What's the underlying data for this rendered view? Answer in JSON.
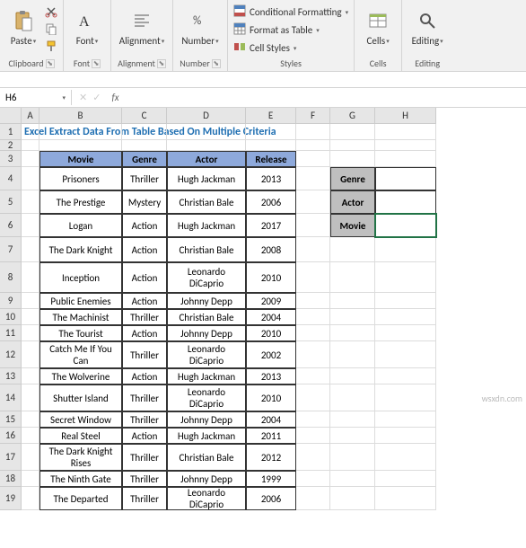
{
  "ribbon": {
    "groups": {
      "clipboard": {
        "label": "Clipboard",
        "paste": "Paste"
      },
      "font": {
        "label": "Font",
        "btn": "Font"
      },
      "alignment": {
        "label": "Alignment",
        "btn": "Alignment"
      },
      "number": {
        "label": "Number",
        "btn": "Number"
      },
      "styles": {
        "label": "Styles",
        "conditional": "Conditional Formatting",
        "format_table": "Format as Table",
        "cell_styles": "Cell Styles"
      },
      "cells": {
        "label": "Cells",
        "btn": "Cells"
      },
      "editing": {
        "label": "Editing",
        "btn": "Editing"
      }
    }
  },
  "namebox": "H6",
  "formula": "",
  "col_labels": [
    "A",
    "B",
    "C",
    "D",
    "E",
    "F",
    "G",
    "H"
  ],
  "row_labels": [
    "1",
    "2",
    "3",
    "4",
    "5",
    "6",
    "7",
    "8",
    "9",
    "10",
    "11",
    "12",
    "13",
    "14",
    "15",
    "16",
    "17",
    "18",
    "19"
  ],
  "title": "Excel Extract Data From Table Based On Multiple Criteria",
  "table": {
    "headers": [
      "Movie",
      "Genre",
      "Actor",
      "Release"
    ],
    "rows": [
      [
        "Prisoners",
        "Thriller",
        "Hugh Jackman",
        "2013"
      ],
      [
        "The Prestige",
        "Mystery",
        "Christian Bale",
        "2006"
      ],
      [
        "Logan",
        "Action",
        "Hugh Jackman",
        "2017"
      ],
      [
        "The Dark Knight",
        "Action",
        "Christian Bale",
        "2008"
      ],
      [
        "Inception",
        "Action",
        "Leonardo DiCaprio",
        "2010"
      ],
      [
        "Public Enemies",
        "Action",
        "Johnny Depp",
        "2009"
      ],
      [
        "The Machinist",
        "Thriller",
        "Christian Bale",
        "2004"
      ],
      [
        "The Tourist",
        "Action",
        "Johnny Depp",
        "2010"
      ],
      [
        "Catch Me If You Can",
        "Thriller",
        "Leonardo DiCaprio",
        "2002"
      ],
      [
        "The Wolverine",
        "Action",
        "Hugh Jackman",
        "2013"
      ],
      [
        "Shutter Island",
        "Thriller",
        "Leonardo DiCaprio",
        "2010"
      ],
      [
        "Secret Window",
        "Thriller",
        "Johnny Depp",
        "2004"
      ],
      [
        "Real Steel",
        "Action",
        "Hugh Jackman",
        "2011"
      ],
      [
        "The Dark Knight Rises",
        "Thriller",
        "Christian Bale",
        "2012"
      ],
      [
        "The Ninth Gate",
        "Thriller",
        "Johnny Depp",
        "1999"
      ],
      [
        "The Departed",
        "Thriller",
        "Leonardo DiCaprio",
        "2006"
      ]
    ]
  },
  "side": {
    "labels": [
      "Genre",
      "Actor",
      "Movie"
    ],
    "values": [
      "",
      "",
      ""
    ]
  },
  "watermark": "wsxdn.com",
  "chart_data": {
    "type": "table",
    "title": "Excel Extract Data From Table Based On Multiple Criteria",
    "columns": [
      "Movie",
      "Genre",
      "Actor",
      "Release"
    ],
    "rows": [
      [
        "Prisoners",
        "Thriller",
        "Hugh Jackman",
        2013
      ],
      [
        "The Prestige",
        "Mystery",
        "Christian Bale",
        2006
      ],
      [
        "Logan",
        "Action",
        "Hugh Jackman",
        2017
      ],
      [
        "The Dark Knight",
        "Action",
        "Christian Bale",
        2008
      ],
      [
        "Inception",
        "Action",
        "Leonardo DiCaprio",
        2010
      ],
      [
        "Public Enemies",
        "Action",
        "Johnny Depp",
        2009
      ],
      [
        "The Machinist",
        "Thriller",
        "Christian Bale",
        2004
      ],
      [
        "The Tourist",
        "Action",
        "Johnny Depp",
        2010
      ],
      [
        "Catch Me If You Can",
        "Thriller",
        "Leonardo DiCaprio",
        2002
      ],
      [
        "The Wolverine",
        "Action",
        "Hugh Jackman",
        2013
      ],
      [
        "Shutter Island",
        "Thriller",
        "Leonardo DiCaprio",
        2010
      ],
      [
        "Secret Window",
        "Thriller",
        "Johnny Depp",
        2004
      ],
      [
        "Real Steel",
        "Action",
        "Hugh Jackman",
        2011
      ],
      [
        "The Dark Knight Rises",
        "Thriller",
        "Christian Bale",
        2012
      ],
      [
        "The Ninth Gate",
        "Thriller",
        "Johnny Depp",
        1999
      ],
      [
        "The Departed",
        "Thriller",
        "Leonardo DiCaprio",
        2006
      ]
    ]
  }
}
